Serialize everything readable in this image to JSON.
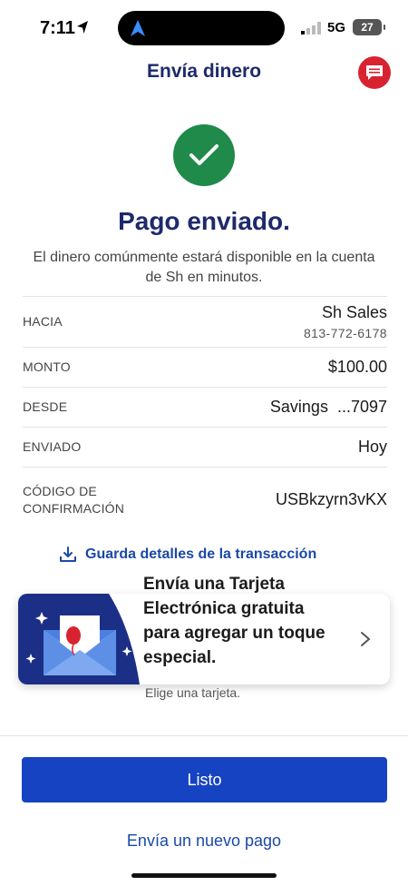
{
  "status_bar": {
    "time": "7:11",
    "network": "5G",
    "battery": "27"
  },
  "header": {
    "title": "Envía dinero",
    "chat_icon": "chat-icon"
  },
  "success": {
    "icon": "checkmark-icon",
    "headline": "Pago enviado.",
    "message": "El dinero comúnmente estará disponible en la cuenta de Sh en minutos."
  },
  "details": {
    "to_label": "HACIA",
    "to_name": "Sh Sales",
    "to_phone": "813-772-6178",
    "amount_label": "MONTO",
    "amount_value": "$100.00",
    "from_label": "DESDE",
    "from_value": "Savings  ...7097",
    "sent_label": "ENVIADO",
    "sent_value": "Hoy",
    "confirmation_label_line1": "CÓDIGO DE",
    "confirmation_label_line2": "CONFIRMACIÓN",
    "confirmation_value": "USBkzyrn3vKX"
  },
  "save_details": {
    "icon": "download-icon",
    "label": "Guarda detalles de la transacción"
  },
  "promo": {
    "title": "Envía una Tarjeta Electrónica gratuita para agregar un toque especial.",
    "subtitle": "Elige una tarjeta.",
    "art": "envelope-balloon-illustration",
    "chevron": "chevron-right-icon"
  },
  "actions": {
    "primary": "Listo",
    "secondary": "Envía un nuevo pago"
  },
  "colors": {
    "brand_navy": "#1e2a6b",
    "primary_blue": "#1643c2",
    "link_blue": "#1a49a8",
    "success_green": "#1f8a4a",
    "alert_red": "#d92230"
  }
}
